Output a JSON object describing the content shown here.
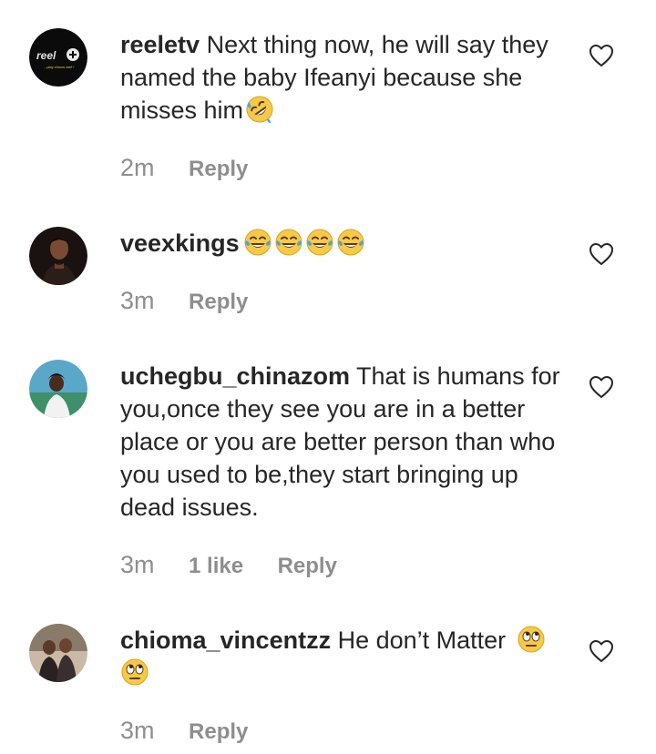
{
  "comments": [
    {
      "username": "reeletv",
      "text": "Next thing now, he will say they named the baby Ifeanyi because she misses him",
      "emoji": "rolling-on-floor-laughing",
      "time": "2m",
      "likes": "",
      "reply_label": "Reply",
      "avatar_logo_text": "reel",
      "avatar_tagline": "...play shows well !"
    },
    {
      "username": "veexkings",
      "text": "",
      "emoji": "tears-of-joy x4",
      "time": "3m",
      "likes": "",
      "reply_label": "Reply"
    },
    {
      "username": "uchegbu_chinazom",
      "text": "That is humans for you,once they see you are in a better place or you are better person than who you used to be,they start bringing up dead issues.",
      "time": "3m",
      "likes": "1 like",
      "reply_label": "Reply"
    },
    {
      "username": "chioma_vincentzz",
      "text": "He don’t Matter",
      "emoji": "rolling-eyes x2",
      "time": "3m",
      "likes": "",
      "reply_label": "Reply"
    }
  ],
  "colors": {
    "text": "#262626",
    "secondary": "#8e8e8e",
    "background": "#ffffff",
    "emoji_yellow": "#f7c948",
    "tear_blue": "#4aa3df"
  },
  "icons": {
    "like": "heart-outline-icon"
  }
}
